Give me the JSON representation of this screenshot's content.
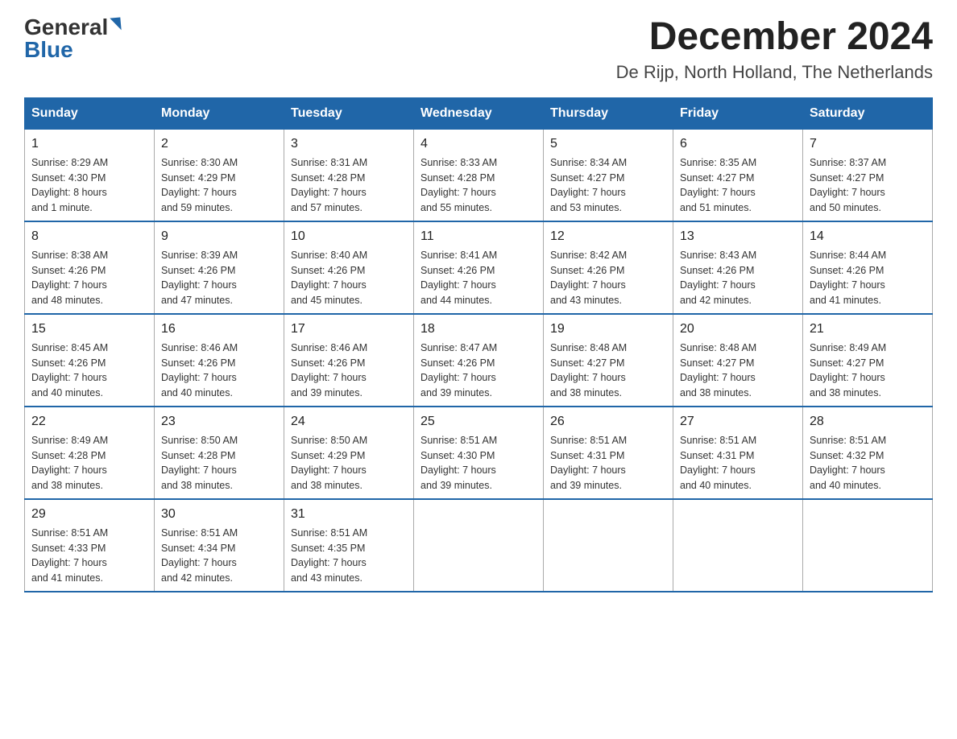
{
  "header": {
    "logo_text1": "General",
    "logo_text2": "Blue",
    "month_year": "December 2024",
    "location": "De Rijp, North Holland, The Netherlands"
  },
  "days_of_week": [
    "Sunday",
    "Monday",
    "Tuesday",
    "Wednesday",
    "Thursday",
    "Friday",
    "Saturday"
  ],
  "weeks": [
    [
      {
        "day": "1",
        "info": "Sunrise: 8:29 AM\nSunset: 4:30 PM\nDaylight: 8 hours\nand 1 minute."
      },
      {
        "day": "2",
        "info": "Sunrise: 8:30 AM\nSunset: 4:29 PM\nDaylight: 7 hours\nand 59 minutes."
      },
      {
        "day": "3",
        "info": "Sunrise: 8:31 AM\nSunset: 4:28 PM\nDaylight: 7 hours\nand 57 minutes."
      },
      {
        "day": "4",
        "info": "Sunrise: 8:33 AM\nSunset: 4:28 PM\nDaylight: 7 hours\nand 55 minutes."
      },
      {
        "day": "5",
        "info": "Sunrise: 8:34 AM\nSunset: 4:27 PM\nDaylight: 7 hours\nand 53 minutes."
      },
      {
        "day": "6",
        "info": "Sunrise: 8:35 AM\nSunset: 4:27 PM\nDaylight: 7 hours\nand 51 minutes."
      },
      {
        "day": "7",
        "info": "Sunrise: 8:37 AM\nSunset: 4:27 PM\nDaylight: 7 hours\nand 50 minutes."
      }
    ],
    [
      {
        "day": "8",
        "info": "Sunrise: 8:38 AM\nSunset: 4:26 PM\nDaylight: 7 hours\nand 48 minutes."
      },
      {
        "day": "9",
        "info": "Sunrise: 8:39 AM\nSunset: 4:26 PM\nDaylight: 7 hours\nand 47 minutes."
      },
      {
        "day": "10",
        "info": "Sunrise: 8:40 AM\nSunset: 4:26 PM\nDaylight: 7 hours\nand 45 minutes."
      },
      {
        "day": "11",
        "info": "Sunrise: 8:41 AM\nSunset: 4:26 PM\nDaylight: 7 hours\nand 44 minutes."
      },
      {
        "day": "12",
        "info": "Sunrise: 8:42 AM\nSunset: 4:26 PM\nDaylight: 7 hours\nand 43 minutes."
      },
      {
        "day": "13",
        "info": "Sunrise: 8:43 AM\nSunset: 4:26 PM\nDaylight: 7 hours\nand 42 minutes."
      },
      {
        "day": "14",
        "info": "Sunrise: 8:44 AM\nSunset: 4:26 PM\nDaylight: 7 hours\nand 41 minutes."
      }
    ],
    [
      {
        "day": "15",
        "info": "Sunrise: 8:45 AM\nSunset: 4:26 PM\nDaylight: 7 hours\nand 40 minutes."
      },
      {
        "day": "16",
        "info": "Sunrise: 8:46 AM\nSunset: 4:26 PM\nDaylight: 7 hours\nand 40 minutes."
      },
      {
        "day": "17",
        "info": "Sunrise: 8:46 AM\nSunset: 4:26 PM\nDaylight: 7 hours\nand 39 minutes."
      },
      {
        "day": "18",
        "info": "Sunrise: 8:47 AM\nSunset: 4:26 PM\nDaylight: 7 hours\nand 39 minutes."
      },
      {
        "day": "19",
        "info": "Sunrise: 8:48 AM\nSunset: 4:27 PM\nDaylight: 7 hours\nand 38 minutes."
      },
      {
        "day": "20",
        "info": "Sunrise: 8:48 AM\nSunset: 4:27 PM\nDaylight: 7 hours\nand 38 minutes."
      },
      {
        "day": "21",
        "info": "Sunrise: 8:49 AM\nSunset: 4:27 PM\nDaylight: 7 hours\nand 38 minutes."
      }
    ],
    [
      {
        "day": "22",
        "info": "Sunrise: 8:49 AM\nSunset: 4:28 PM\nDaylight: 7 hours\nand 38 minutes."
      },
      {
        "day": "23",
        "info": "Sunrise: 8:50 AM\nSunset: 4:28 PM\nDaylight: 7 hours\nand 38 minutes."
      },
      {
        "day": "24",
        "info": "Sunrise: 8:50 AM\nSunset: 4:29 PM\nDaylight: 7 hours\nand 38 minutes."
      },
      {
        "day": "25",
        "info": "Sunrise: 8:51 AM\nSunset: 4:30 PM\nDaylight: 7 hours\nand 39 minutes."
      },
      {
        "day": "26",
        "info": "Sunrise: 8:51 AM\nSunset: 4:31 PM\nDaylight: 7 hours\nand 39 minutes."
      },
      {
        "day": "27",
        "info": "Sunrise: 8:51 AM\nSunset: 4:31 PM\nDaylight: 7 hours\nand 40 minutes."
      },
      {
        "day": "28",
        "info": "Sunrise: 8:51 AM\nSunset: 4:32 PM\nDaylight: 7 hours\nand 40 minutes."
      }
    ],
    [
      {
        "day": "29",
        "info": "Sunrise: 8:51 AM\nSunset: 4:33 PM\nDaylight: 7 hours\nand 41 minutes."
      },
      {
        "day": "30",
        "info": "Sunrise: 8:51 AM\nSunset: 4:34 PM\nDaylight: 7 hours\nand 42 minutes."
      },
      {
        "day": "31",
        "info": "Sunrise: 8:51 AM\nSunset: 4:35 PM\nDaylight: 7 hours\nand 43 minutes."
      },
      {
        "day": "",
        "info": ""
      },
      {
        "day": "",
        "info": ""
      },
      {
        "day": "",
        "info": ""
      },
      {
        "day": "",
        "info": ""
      }
    ]
  ]
}
